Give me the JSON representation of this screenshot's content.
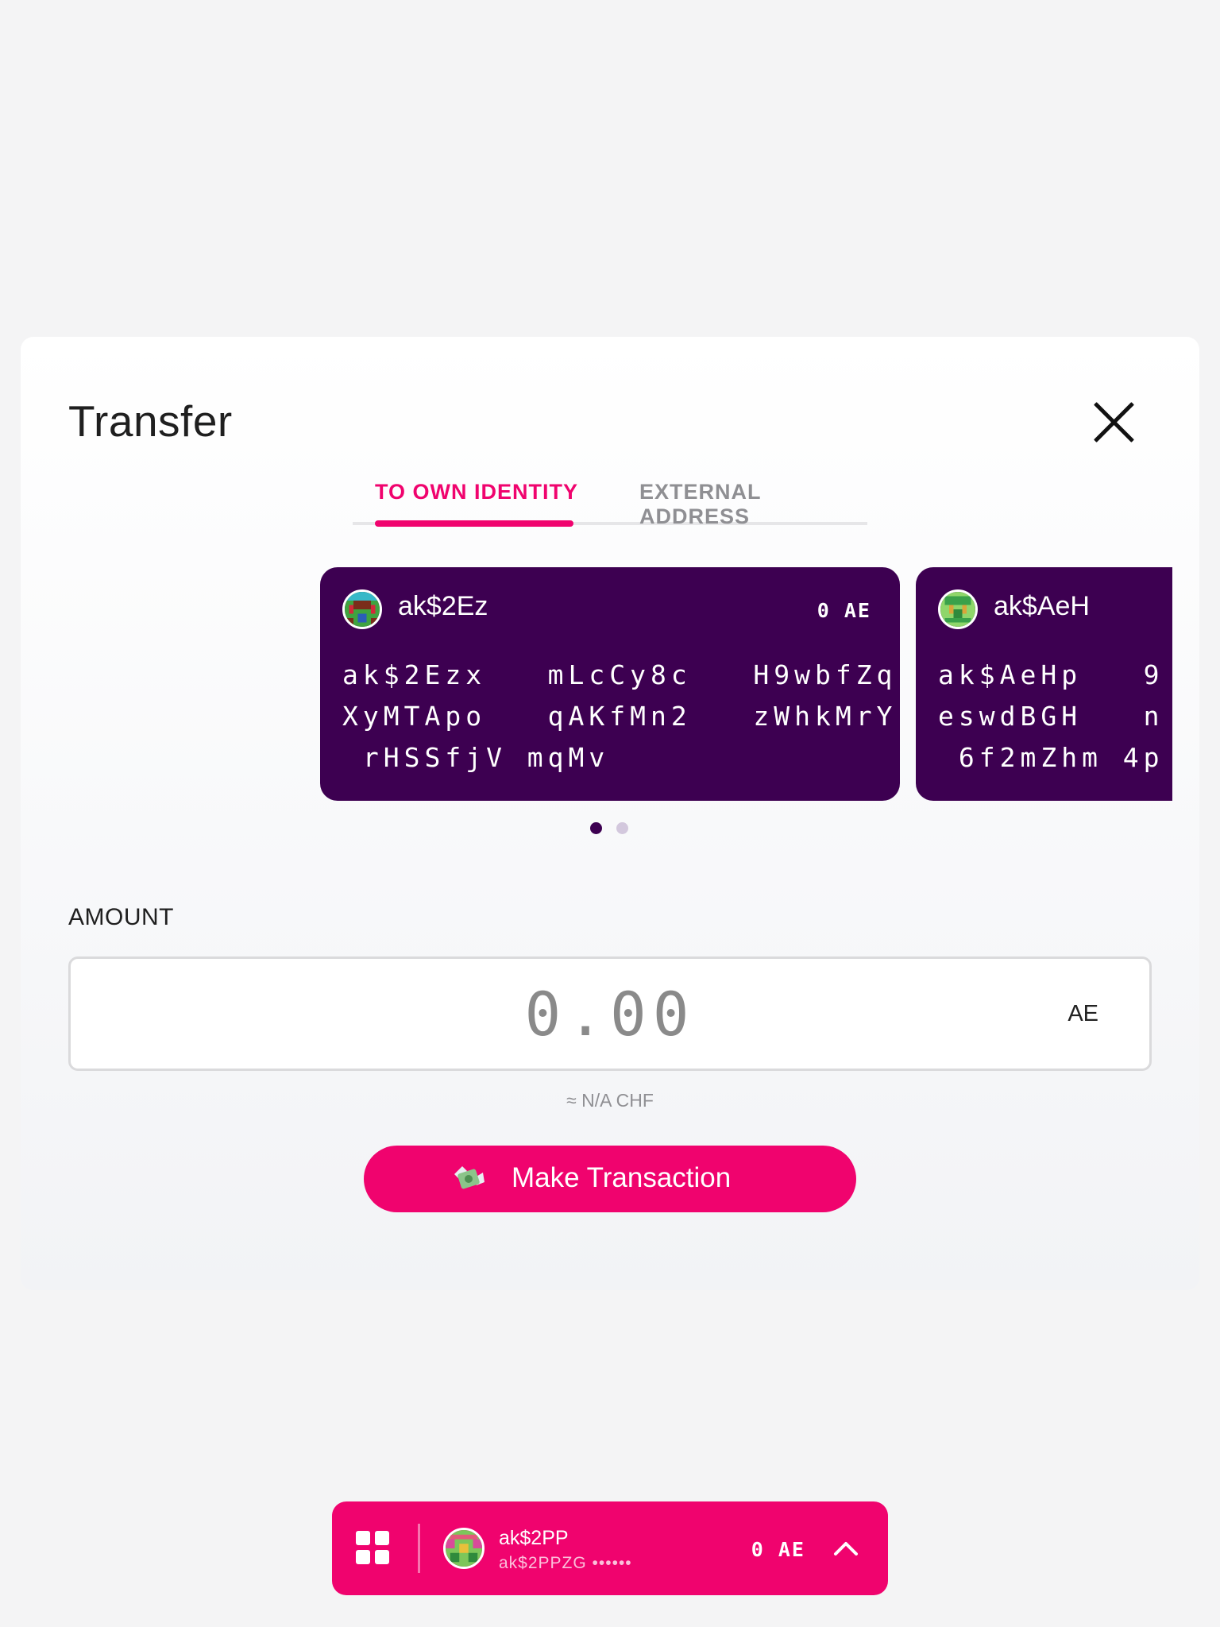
{
  "modal": {
    "title": "Transfer",
    "tabs": [
      {
        "label": "TO OWN IDENTITY",
        "active": true
      },
      {
        "label": "EXTERNAL ADDRESS",
        "active": false
      }
    ]
  },
  "accounts": [
    {
      "name": "ak$2Ez",
      "balance": "0 AE",
      "address_lines": [
        "ak$2Ezx   mLcCy8c   H9wbfZq",
        "XyMTApo   qAKfMn2   zWhkMrY",
        " rHSSfjV mqMv"
      ]
    },
    {
      "name": "ak$AeH",
      "balance": "",
      "address_lines": [
        "ak$AeHp   9",
        "eswdBGH   n",
        " 6f2mZhm 4p"
      ]
    }
  ],
  "carousel": {
    "page_count": 2,
    "active_page": 1
  },
  "amount": {
    "label": "AMOUNT",
    "placeholder": "0.00",
    "value": "",
    "unit": "AE",
    "fiat": "≈ N/A CHF"
  },
  "cta": {
    "label": "Make Transaction",
    "icon": "money-with-wings-icon"
  },
  "bottom_bar": {
    "name": "ak$2PP",
    "address": "ak$2PPZG ••••••",
    "balance": "0 AE"
  },
  "colors": {
    "accent": "#f0036e",
    "card_bg": "#3d0051",
    "background": "#f4f4f5"
  }
}
